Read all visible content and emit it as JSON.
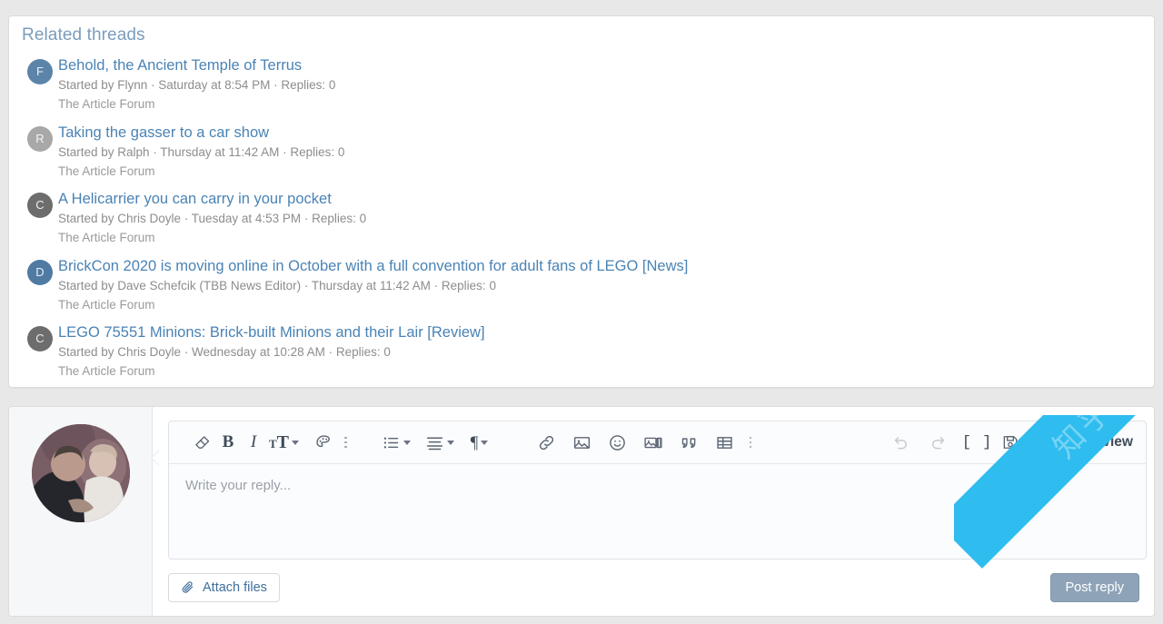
{
  "related": {
    "title": "Related threads",
    "threads": [
      {
        "initial": "F",
        "avatar_color": "#5b84a8",
        "title": "Behold, the Ancient Temple of Terrus",
        "meta": "Started by Flynn · Saturday at 8:54 PM · Replies: 0",
        "forum": "The Article Forum"
      },
      {
        "initial": "R",
        "avatar_color": "#a8a8a8",
        "title": "Taking the gasser to a car show",
        "meta": "Started by Ralph · Thursday at 11:42 AM · Replies: 0",
        "forum": "The Article Forum"
      },
      {
        "initial": "C",
        "avatar_color": "#6d6d6d",
        "title": "A Helicarrier you can carry in your pocket",
        "meta": "Started by Chris Doyle · Tuesday at 4:53 PM · Replies: 0",
        "forum": "The Article Forum"
      },
      {
        "initial": "D",
        "avatar_color": "#4f7ba3",
        "title": "BrickCon 2020 is moving online in October with a full convention for adult fans of LEGO [News]",
        "meta": "Started by Dave Schefcik (TBB News Editor) · Thursday at 11:42 AM · Replies: 0",
        "forum": "The Article Forum"
      },
      {
        "initial": "C",
        "avatar_color": "#6d6d6d",
        "title": "LEGO 75551 Minions: Brick-built Minions and their Lair [Review]",
        "meta": "Started by Chris Doyle · Wednesday at 10:28 AM · Replies: 0",
        "forum": "The Article Forum"
      }
    ]
  },
  "reply": {
    "editor": {
      "placeholder": "Write your reply...",
      "toolbar": {
        "remove_format": "remove-formatting-icon",
        "bold": "B",
        "italic": "I",
        "text_size": "text-size-icon",
        "text_color": "text-color-icon",
        "more_inline": "more-inline-icon",
        "list": "bullet-list-icon",
        "align": "align-icon",
        "paragraph": "¶",
        "link": "link-icon",
        "image": "image-icon",
        "emoji": "emoji-icon",
        "media": "media-icon",
        "quote": "quote-icon",
        "table": "table-icon",
        "more_block": "more-block-icon",
        "undo": "undo-icon",
        "redo": "redo-icon",
        "bbcode": "[ ]",
        "draft": "draft-icon"
      },
      "preview_label": "Preview"
    },
    "attach_label": "Attach files",
    "post_label": "Post reply"
  },
  "watermark": {
    "text": "知乎"
  },
  "colors": {
    "link": "#4a83b5",
    "heading": "#7b9cbd",
    "meta": "#8d8d8d",
    "watermark": "#2fbdf0",
    "post_button": "#8fa3b8"
  }
}
